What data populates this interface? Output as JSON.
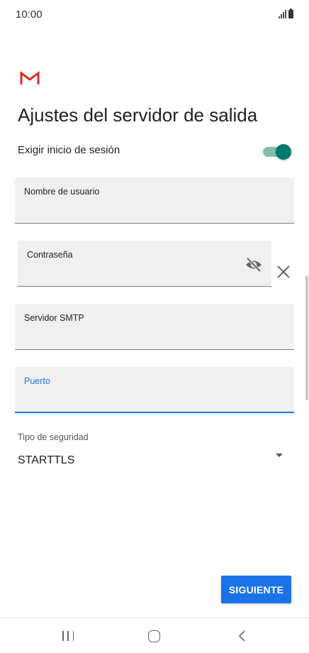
{
  "status_bar": {
    "time": "10:00"
  },
  "page": {
    "title": "Ajustes del servidor de salida"
  },
  "login_toggle": {
    "label": "Exigir inicio de sesión",
    "checked": true
  },
  "fields": {
    "username": {
      "label": "Nombre de usuario",
      "value": ""
    },
    "password": {
      "label": "Contraseña",
      "value": ""
    },
    "smtp_server": {
      "label": "Servidor SMTP",
      "value": ""
    },
    "port": {
      "label": "Puerto",
      "value": "",
      "focused": true
    }
  },
  "security": {
    "label": "Tipo de seguridad",
    "value": "STARTTLS"
  },
  "actions": {
    "next_label": "SIGUIENTE"
  },
  "icons": [
    "gmail-logo",
    "visibility-off-icon",
    "clear-icon",
    "dropdown-arrow-icon",
    "recents-icon",
    "home-icon",
    "back-icon"
  ],
  "colors": {
    "accent": "#1a73e8",
    "toggle": "#00796b"
  }
}
